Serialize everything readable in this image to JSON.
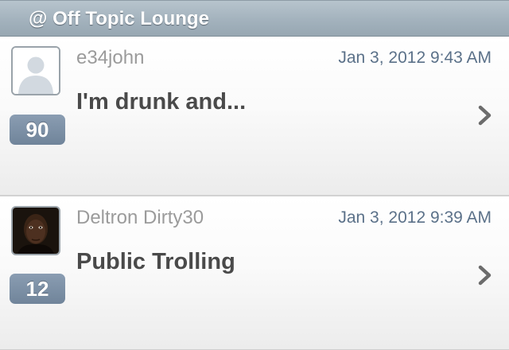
{
  "section": {
    "title": "@ Off Topic Lounge"
  },
  "threads": [
    {
      "username": "e34john",
      "timestamp": "Jan 3, 2012 9:43 AM",
      "title": "I'm drunk and...",
      "count": "90",
      "avatar": "default-person-silhouette"
    },
    {
      "username": "Deltron Dirty30",
      "timestamp": "Jan 3, 2012 9:39 AM",
      "title": "Public Trolling",
      "count": "12",
      "avatar": "user-photo"
    }
  ],
  "colors": {
    "header_bg": "#a3b2bd",
    "badge_bg": "#7a8ea4",
    "timestamp": "#5b7189",
    "title": "#4a4a4a",
    "username": "#9b9b9b"
  },
  "icons": {
    "disclosure": "chevron-right-icon"
  }
}
